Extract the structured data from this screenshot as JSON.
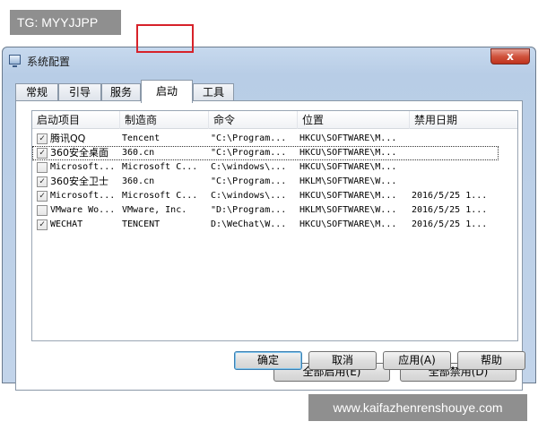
{
  "watermarks": {
    "top": "TG: MYYJJPP",
    "bottom": "www.kaifazhenrenshouye.com"
  },
  "window": {
    "title": "系统配置",
    "close_label": "x"
  },
  "tabs": [
    {
      "label": "常规"
    },
    {
      "label": "引导"
    },
    {
      "label": "服务"
    },
    {
      "label": "启动"
    },
    {
      "label": "工具"
    }
  ],
  "startup": {
    "columns": [
      "启动项目",
      "制造商",
      "命令",
      "位置",
      "禁用日期"
    ],
    "rows": [
      {
        "checked": "✓",
        "name": "腾讯QQ",
        "maker": "Tencent",
        "command": "\"C:\\Program...",
        "location": "HKCU\\SOFTWARE\\M...",
        "date": ""
      },
      {
        "checked": "✓",
        "name": "360安全桌面",
        "maker": "360.cn",
        "command": "\"C:\\Program...",
        "location": "HKCU\\SOFTWARE\\M...",
        "date": ""
      },
      {
        "checked": "",
        "name": "Microsoft...",
        "maker": "Microsoft C...",
        "command": "C:\\windows\\...",
        "location": "HKCU\\SOFTWARE\\M...",
        "date": ""
      },
      {
        "checked": "✓",
        "name": "360安全卫士",
        "maker": "360.cn",
        "command": "\"C:\\Program...",
        "location": "HKLM\\SOFTWARE\\W...",
        "date": ""
      },
      {
        "checked": "✓",
        "name": "Microsoft...",
        "maker": "Microsoft C...",
        "command": "C:\\windows\\...",
        "location": "HKCU\\SOFTWARE\\M...",
        "date": "2016/5/25 1..."
      },
      {
        "checked": "",
        "name": "VMware Wo...",
        "maker": "VMware, Inc.",
        "command": "\"D:\\Program...",
        "location": "HKLM\\SOFTWARE\\W...",
        "date": "2016/5/25 1..."
      },
      {
        "checked": "✓",
        "name": "WECHAT",
        "maker": "TENCENT",
        "command": "D:\\WeChat\\W...",
        "location": "HKCU\\SOFTWARE\\M...",
        "date": "2016/5/25 1..."
      }
    ],
    "enable_all": "全部启用(E)",
    "disable_all": "全部禁用(D)"
  },
  "footer": {
    "ok": "确定",
    "cancel": "取消",
    "apply": "应用(A)",
    "help": "帮助"
  }
}
